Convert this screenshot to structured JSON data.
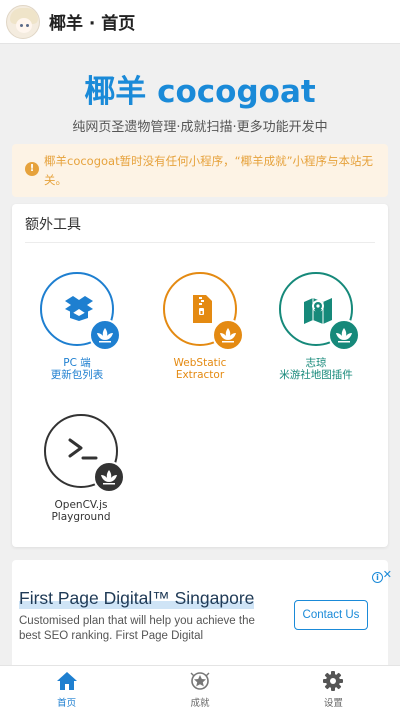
{
  "header": {
    "title": "椰羊 · 首页"
  },
  "hero": {
    "title": "椰羊 cocogoat",
    "subtitle": "纯网页圣遗物管理·成就扫描·更多功能开发中"
  },
  "notice": {
    "icon": "info-icon",
    "text": "椰羊cocogoat暂时没有任何小程序，“椰羊成就”小程序与本站无关。"
  },
  "tools_card": {
    "title": "额外工具",
    "tools": [
      {
        "line1": "PC 端",
        "line2": "更新包列表",
        "icon": "package-icon",
        "color": "#1e7fd0"
      },
      {
        "line1": "WebStatic",
        "line2": "Extractor",
        "icon": "zip-file-icon",
        "color": "#e48a12"
      },
      {
        "line1": "志琼",
        "line2": "米游社地图插件",
        "icon": "map-pin-icon",
        "color": "#16897a"
      },
      {
        "line1": "OpenCV.js",
        "line2": "Playground",
        "icon": "terminal-icon",
        "color": "#333333"
      }
    ]
  },
  "ad": {
    "title": "First Page Digital™ Singapore",
    "body": "Customised plan that will help you achieve the best SEO ranking. First Page Digital",
    "button": "Contact Us"
  },
  "tabbar": {
    "active_color": "#1e7fd0",
    "items": [
      {
        "label": "首页",
        "icon": "home-icon"
      },
      {
        "label": "成就",
        "icon": "achievement-icon"
      },
      {
        "label": "设置",
        "icon": "gear-icon"
      }
    ]
  }
}
